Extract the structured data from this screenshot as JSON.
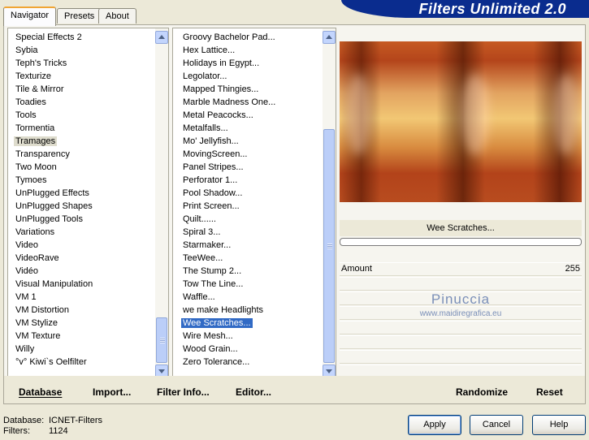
{
  "tabs": [
    "Navigator",
    "Presets",
    "About"
  ],
  "banner_title": "Filters Unlimited 2.0",
  "categories": [
    "Special Effects 2",
    "Sybia",
    "Teph's Tricks",
    "Texturize",
    "Tile & Mirror",
    "Toadies",
    "Tools",
    "Tormentia",
    "Tramages",
    "Transparency",
    "Two Moon",
    "Tymoes",
    "UnPlugged Effects",
    "UnPlugged Shapes",
    "UnPlugged Tools",
    "Variations",
    "Video",
    "VideoRave",
    "Vidéo",
    "Visual Manipulation",
    "VM 1",
    "VM Distortion",
    "VM Stylize",
    "VM Texture",
    "Willy",
    "°v° Kiwi`s Oelfilter"
  ],
  "selected_category": "Tramages",
  "filters": [
    "Groovy Bachelor Pad...",
    "Hex Lattice...",
    "Holidays in Egypt...",
    "Legolator...",
    "Mapped Thingies...",
    "Marble Madness One...",
    "Metal Peacocks...",
    "Metalfalls...",
    "Mo' Jellyfish...",
    "MovingScreen...",
    "Panel Stripes...",
    "Perforator 1...",
    "Pool Shadow...",
    "Print Screen...",
    "Quilt......",
    "Spiral 3...",
    "Starmaker...",
    "TeeWee...",
    "The Stump 2...",
    "Tow The Line...",
    "Waffle...",
    "we make Headlights",
    "Wee Scratches...",
    "Wire Mesh...",
    "Wood Grain...",
    "Zero Tolerance..."
  ],
  "selected_filter": "Wee Scratches...",
  "current_filter_name": "Wee Scratches...",
  "parameter": {
    "label": "Amount",
    "value": "255"
  },
  "watermark": {
    "name": "Pinuccia",
    "url": "www.maidiregrafica.eu"
  },
  "bottom_links": {
    "database": "Database",
    "import": "Import...",
    "filter_info": "Filter Info...",
    "editor": "Editor...",
    "randomize": "Randomize",
    "reset": "Reset"
  },
  "status": {
    "database_label": "Database:",
    "database_value": "ICNET-Filters",
    "filters_label": "Filters:",
    "filters_value": "1124"
  },
  "buttons": {
    "apply": "Apply",
    "cancel": "Cancel",
    "help": "Help"
  },
  "category_scroll_position": 0.93,
  "filter_scroll_position": 1.0,
  "colors": {
    "selection": "#316AC5",
    "banner": "#0A2C8E",
    "tab_highlight": "#F0A535"
  }
}
